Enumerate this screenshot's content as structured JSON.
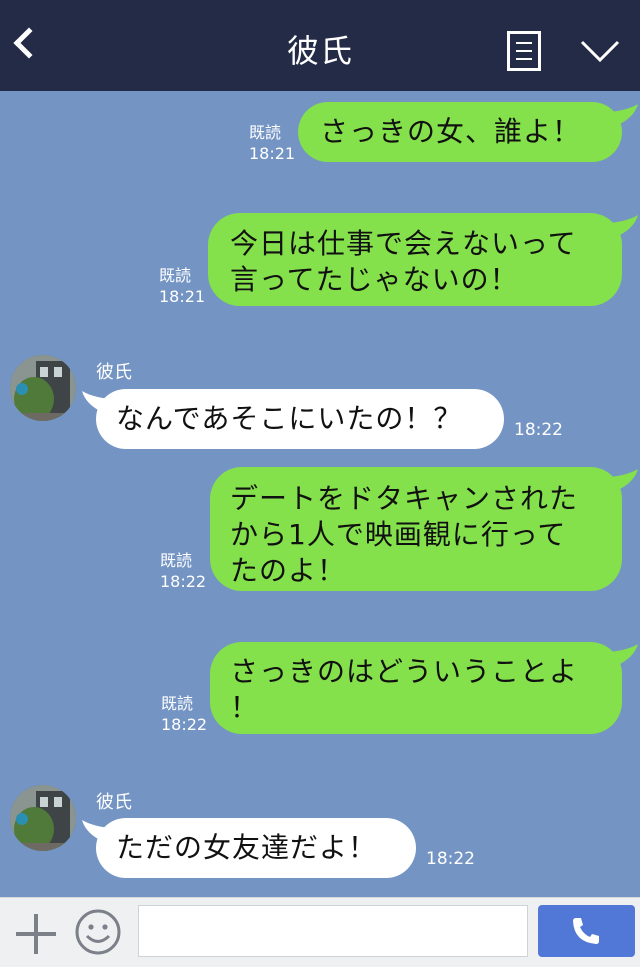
{
  "header": {
    "title": "彼氏"
  },
  "messages": [
    {
      "from": "me",
      "text": "さっきの女、誰よ！",
      "read": "既読",
      "time": "18:21"
    },
    {
      "from": "me",
      "lines": [
        "今日は仕事で会えないって",
        "言ってたじゃないの！"
      ],
      "read": "既読",
      "time": "18:21"
    },
    {
      "from": "them",
      "sender": "彼氏",
      "text": "なんであそこにいたの！？",
      "time": "18:22"
    },
    {
      "from": "me",
      "lines": [
        "デートをドタキャンされた",
        "から1人で映画観に行って",
        "たのよ！"
      ],
      "read": "既読",
      "time": "18:22"
    },
    {
      "from": "me",
      "lines": [
        "さっきのはどういうことよ",
        "！"
      ],
      "read": "既読",
      "time": "18:22"
    },
    {
      "from": "them",
      "sender": "彼氏",
      "text": "ただの女友達だよ！",
      "time": "18:22"
    }
  ],
  "footer": {
    "input_value": ""
  },
  "colors": {
    "background": "#7495c4",
    "header": "#232b46",
    "my_bubble": "#84e04b",
    "their_bubble": "#ffffff",
    "send_button": "#5178d6"
  }
}
